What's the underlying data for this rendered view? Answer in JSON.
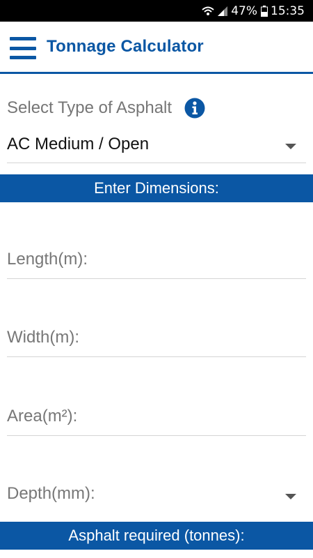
{
  "status_bar": {
    "battery": "47%",
    "time": "15:35",
    "icons": [
      "wifi-icon",
      "signal-icon",
      "battery-icon"
    ]
  },
  "app_bar": {
    "title": "Tonnage Calculator",
    "menu_icon": "hamburger-menu-icon"
  },
  "asphalt_type": {
    "label": "Select Type of Asphalt",
    "info_icon": "info-icon",
    "selected": "AC Medium / Open"
  },
  "dimensions": {
    "heading": "Enter Dimensions:",
    "length_label": "Length(m):",
    "width_label": "Width(m):",
    "area_label": "Area(m²):",
    "depth_label": "Depth(mm):"
  },
  "result": {
    "heading": "Asphalt required (tonnes):"
  },
  "colors": {
    "primary": "#0b57a4",
    "status_bar": "#000000"
  }
}
